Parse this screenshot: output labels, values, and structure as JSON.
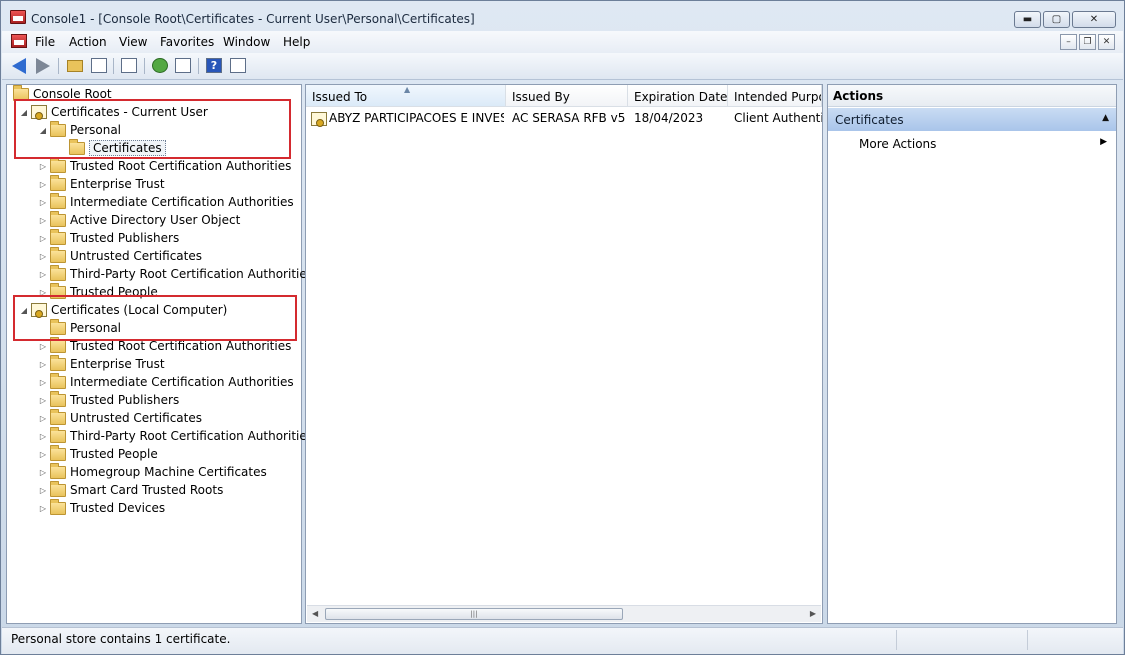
{
  "window": {
    "title": "Console1 - [Console Root\\Certificates - Current User\\Personal\\Certificates]",
    "minimize": "▬",
    "maximize": "▢",
    "close": "✕"
  },
  "menu": {
    "items": [
      "File",
      "Action",
      "View",
      "Favorites",
      "Window",
      "Help"
    ],
    "mdi": {
      "minimize": "–",
      "restore": "❐",
      "close": "✕"
    }
  },
  "toolbar": {
    "help_label": "?"
  },
  "tree": {
    "root": "Console Root",
    "current_user": {
      "label": "Certificates - Current User",
      "personal": "Personal",
      "certificates": "Certificates",
      "children": [
        "Trusted Root Certification Authorities",
        "Enterprise Trust",
        "Intermediate Certification Authorities",
        "Active Directory User Object",
        "Trusted Publishers",
        "Untrusted Certificates",
        "Third-Party Root Certification Authorities",
        "Trusted People"
      ]
    },
    "local_computer": {
      "label": "Certificates (Local Computer)",
      "personal": "Personal",
      "children": [
        "Trusted Root Certification Authorities",
        "Enterprise Trust",
        "Intermediate Certification Authorities",
        "Trusted Publishers",
        "Untrusted Certificates",
        "Third-Party Root Certification Authorities",
        "Trusted People",
        "Homegroup Machine Certificates",
        "Smart Card Trusted Roots",
        "Trusted Devices"
      ]
    },
    "expander_open": "◢",
    "expander_closed": "▷"
  },
  "list": {
    "columns": [
      "Issued To",
      "Issued By",
      "Expiration Date",
      "Intended Purpos"
    ],
    "rows": [
      {
        "issued_to": "ABYZ PARTICIPACOES E INVES...",
        "issued_by": "AC SERASA RFB v5",
        "expiration": "18/04/2023",
        "purpose": "Client Authentic"
      }
    ],
    "sort_indicator": "▲"
  },
  "actions": {
    "header": "Actions",
    "section": "Certificates",
    "section_arrow": "▲",
    "items": [
      "More Actions"
    ],
    "item_arrow": "▶"
  },
  "status": {
    "text": "Personal store contains 1 certificate."
  },
  "colors": {
    "highlight": "#d42a2f",
    "accent": "#2f6bd0"
  }
}
